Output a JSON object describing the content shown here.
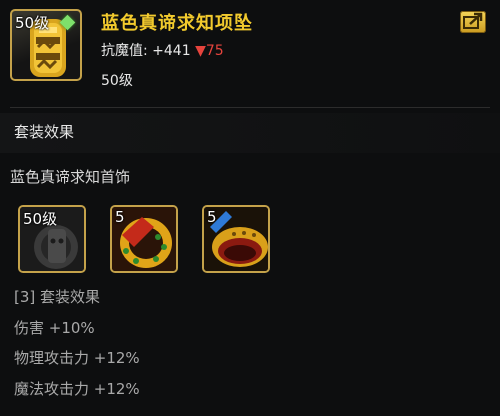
{
  "item": {
    "level_badge": "50级",
    "name": "蓝色真谛求知项坠",
    "stat_label": "抗魔值:",
    "stat_value": "+441",
    "stat_diff": "▼75",
    "required_level": "50级"
  },
  "set": {
    "section_title": "套装效果",
    "name": "蓝色真谛求知首饰",
    "pieces": [
      {
        "level_badge": "50级",
        "icon": "bracelet-locked"
      },
      {
        "level_badge": "5",
        "icon": "bracelet-red"
      },
      {
        "level_badge": "5",
        "icon": "ring-gold"
      }
    ],
    "bonus_header": "[3] 套装效果",
    "bonuses": [
      "伤害 +10%",
      "物理攻击力 +12%",
      "魔法攻击力 +12%"
    ]
  },
  "colors": {
    "title": "#f2ca2d",
    "border_gold": "#c4a24a",
    "stat_decrease": "#e6443d"
  }
}
